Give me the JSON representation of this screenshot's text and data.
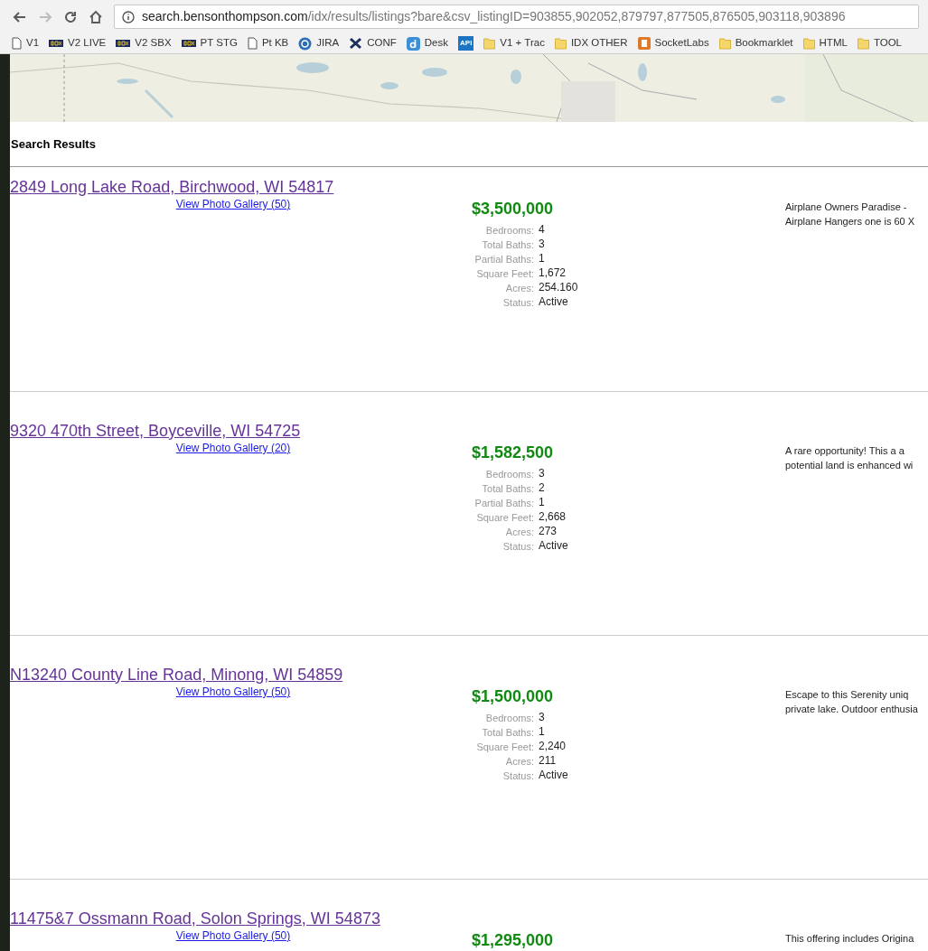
{
  "toolbar": {
    "nav_buttons": [
      {
        "kind": "back",
        "disabled": false
      },
      {
        "kind": "forward",
        "disabled": true
      },
      {
        "kind": "reload",
        "disabled": false
      },
      {
        "kind": "home",
        "disabled": false
      }
    ],
    "url_host": "search.bensonthompson.com",
    "url_path": "/idx/results/listings?bare&csv_listingID=903855,902052,879797,877505,876505,903118,903896"
  },
  "bookmarks": [
    {
      "kind": "page",
      "label": "V1"
    },
    {
      "kind": "logo",
      "label": "V2 LIVE"
    },
    {
      "kind": "logo",
      "label": "V2 SBX"
    },
    {
      "kind": "logo",
      "label": "PT STG"
    },
    {
      "kind": "page",
      "label": "Pt KB"
    },
    {
      "kind": "ring",
      "label": "JIRA"
    },
    {
      "kind": "cross",
      "label": "CONF"
    },
    {
      "kind": "letter",
      "label": "Desk"
    },
    {
      "kind": "tile",
      "label": "API"
    },
    {
      "kind": "folder",
      "label": "V1 + Trac"
    },
    {
      "kind": "folder",
      "label": "IDX OTHER"
    },
    {
      "kind": "square",
      "label": "SocketLabs"
    },
    {
      "kind": "folder",
      "label": "Bookmarklet"
    },
    {
      "kind": "folder",
      "label": "HTML"
    },
    {
      "kind": "folder",
      "label": "TOOL"
    }
  ],
  "heading": "Search Results",
  "listings": [
    {
      "address": "2849 Long Lake Road, Birchwood, WI 54817",
      "gallery_link": "View Photo Gallery (50)",
      "price": "$3,500,000",
      "details": [
        {
          "label": "Bedrooms:",
          "value": "4"
        },
        {
          "label": "Total Baths:",
          "value": "3"
        },
        {
          "label": "Partial Baths:",
          "value": "1"
        },
        {
          "label": "Square Feet:",
          "value": "1,672"
        },
        {
          "label": "Acres:",
          "value": "254.160"
        },
        {
          "label": "Status:",
          "value": "Active"
        }
      ],
      "description_lines": [
        "Airplane Owners Paradise -",
        "Airplane Hangers one is 60 X"
      ]
    },
    {
      "address": "9320 470th Street, Boyceville, WI 54725",
      "gallery_link": "View Photo Gallery (20)",
      "price": "$1,582,500",
      "details": [
        {
          "label": "Bedrooms:",
          "value": "3"
        },
        {
          "label": "Total Baths:",
          "value": "2"
        },
        {
          "label": "Partial Baths:",
          "value": "1"
        },
        {
          "label": "Square Feet:",
          "value": "2,668"
        },
        {
          "label": "Acres:",
          "value": "273"
        },
        {
          "label": "Status:",
          "value": "Active"
        }
      ],
      "description_lines": [
        "A rare opportunity! This a a",
        "potential land is enhanced wi"
      ]
    },
    {
      "address": "N13240 County Line Road, Minong, WI 54859",
      "gallery_link": "View Photo Gallery (50)",
      "price": "$1,500,000",
      "details": [
        {
          "label": "Bedrooms:",
          "value": "3"
        },
        {
          "label": "Total Baths:",
          "value": "1"
        },
        {
          "label": "Square Feet:",
          "value": "2,240"
        },
        {
          "label": "Acres:",
          "value": "211"
        },
        {
          "label": "Status:",
          "value": "Active"
        }
      ],
      "description_lines": [
        "Escape to this Serenity uniq",
        "private lake. Outdoor enthusia"
      ]
    },
    {
      "address": "11475&7 Ossmann Road, Solon Springs, WI 54873",
      "gallery_link": "View Photo Gallery (50)",
      "price": "$1,295,000",
      "description_lines": [
        "This offering includes Origina"
      ]
    }
  ]
}
